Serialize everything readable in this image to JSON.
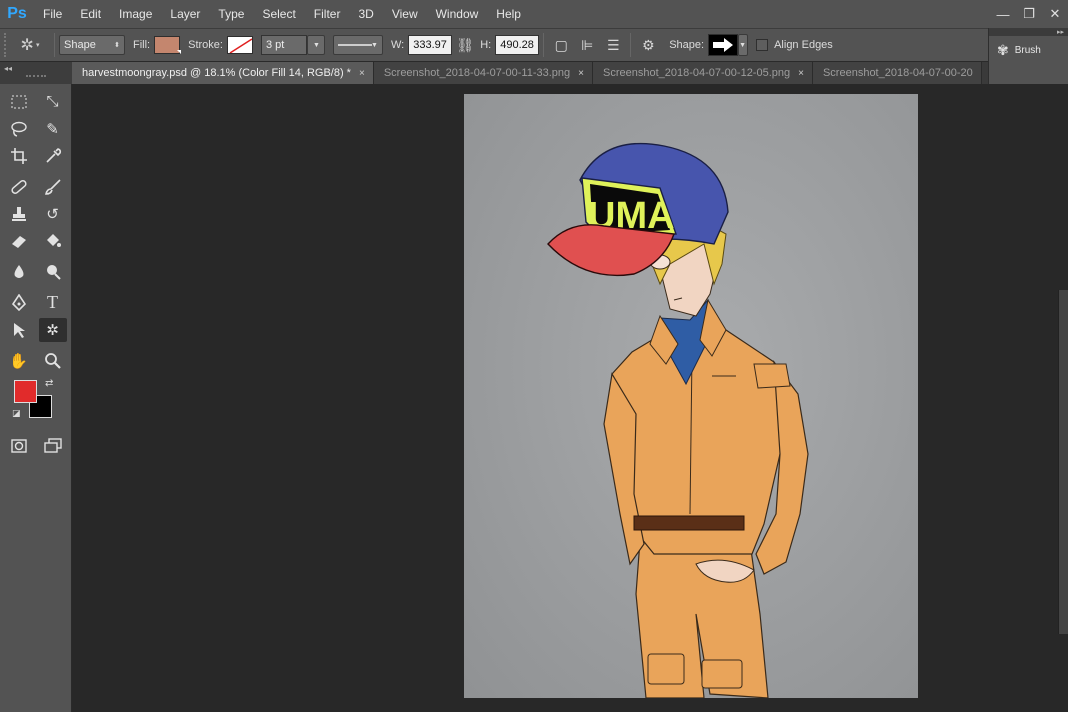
{
  "app": {
    "logo": "Ps"
  },
  "menu": [
    "File",
    "Edit",
    "Image",
    "Layer",
    "Type",
    "Select",
    "Filter",
    "3D",
    "View",
    "Window",
    "Help"
  ],
  "window_controls": {
    "minimize": "—",
    "restore": "❐",
    "close": "✕"
  },
  "options": {
    "mode": "Shape",
    "fill_label": "Fill:",
    "fill_color": "#c4866e",
    "stroke_label": "Stroke:",
    "stroke_width": "3 pt",
    "w_label": "W:",
    "w_value": "333.97",
    "h_label": "H:",
    "h_value": "490.28",
    "shape_label": "Shape:",
    "align_edges_label": "Align Edges"
  },
  "panel": {
    "brush_label": "Brush"
  },
  "tabs": [
    {
      "label": "harvestmoongray.psd @ 18.1% (Color Fill 14, RGB/8) *",
      "active": true
    },
    {
      "label": "Screenshot_2018-04-07-00-11-33.png",
      "active": false
    },
    {
      "label": "Screenshot_2018-04-07-00-12-05.png",
      "active": false
    },
    {
      "label": "Screenshot_2018-04-07-00-20",
      "active": false
    }
  ],
  "tab_close": "×",
  "colors": {
    "foreground": "#e12b2b",
    "background": "#000000",
    "accent": "#31a8ff"
  },
  "artwork": {
    "cap_text": "UMA"
  }
}
